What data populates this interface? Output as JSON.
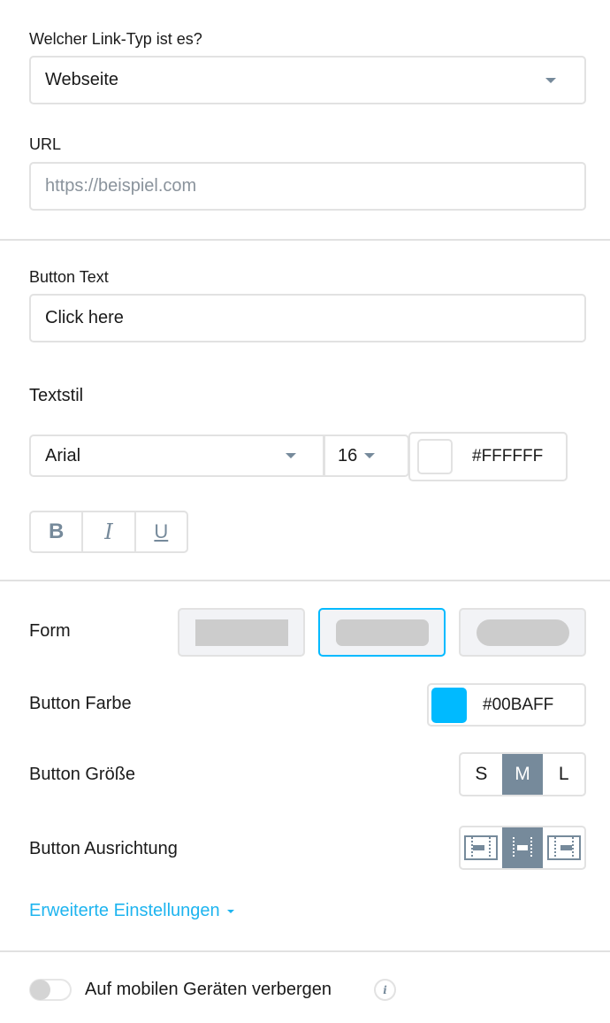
{
  "link_type": {
    "label": "Welcher Link-Typ ist es?",
    "value": "Webseite",
    "caret_icon": "caret-down-icon"
  },
  "url": {
    "label": "URL",
    "placeholder": "https://beispiel.com",
    "value": ""
  },
  "button_text": {
    "label": "Button Text",
    "value": "Click here"
  },
  "text_style": {
    "label": "Textstil",
    "font_family": "Arial",
    "font_size": "16",
    "text_color": "#FFFFFF",
    "style_buttons": [
      {
        "label": "B",
        "name": "bold"
      },
      {
        "label": "I",
        "name": "italic"
      },
      {
        "label": "U",
        "name": "underline"
      }
    ]
  },
  "form": {
    "label": "Form",
    "options": [
      "square",
      "rounded",
      "pill"
    ],
    "selected": "rounded"
  },
  "button_color": {
    "label": "Button Farbe",
    "value": "#00BAFF"
  },
  "button_size": {
    "label": "Button Größe",
    "options": [
      "S",
      "M",
      "L"
    ],
    "selected": "M"
  },
  "button_alignment": {
    "label": "Button Ausrichtung",
    "options": [
      "align-left-icon",
      "align-center-icon",
      "align-right-icon"
    ],
    "selected": "center"
  },
  "advanced": {
    "label": "Erweiterte Einstellungen"
  },
  "hide_mobile": {
    "label": "Auf mobilen Geräten verbergen",
    "enabled": false,
    "info_icon": "info-icon"
  },
  "colors": {
    "accent": "#00BAFF",
    "link": "#1EB4EF",
    "muted_icon": "#768A9B",
    "border": "#E2E2E2",
    "shape_preview": "#CCCCCC"
  }
}
